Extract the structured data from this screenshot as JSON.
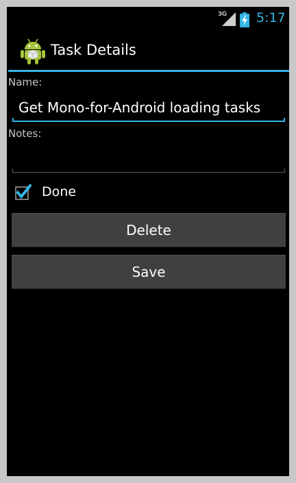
{
  "status_bar": {
    "network_type": "3G",
    "time": "5:17",
    "signal_icon": "cell-signal-icon",
    "battery_icon": "battery-charging-icon"
  },
  "action_bar": {
    "title": "Task Details",
    "icon": "android-robot-icon"
  },
  "form": {
    "name_label": "Name:",
    "name_value": "Get Mono-for-Android loading tasks",
    "notes_label": "Notes:",
    "notes_value": "",
    "done_label": "Done",
    "done_checked": true
  },
  "buttons": {
    "delete_label": "Delete",
    "save_label": "Save"
  },
  "colors": {
    "accent": "#33b5e5",
    "background": "#000000",
    "button": "#404040",
    "android_green": "#a4c639"
  }
}
